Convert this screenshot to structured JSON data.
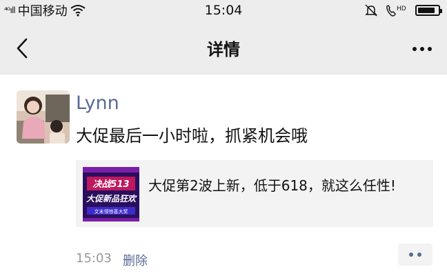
{
  "status_bar": {
    "signal": "⁴ᴳıll",
    "carrier": "中国移动",
    "time": "15:04",
    "hd_label": "HD",
    "battery_level": 0.85
  },
  "nav": {
    "title": "详情",
    "back_icon": "chevron-left-icon",
    "more_icon": "more-dots-icon"
  },
  "post": {
    "author": "Lynn",
    "text": "大促最后一小时啦，抓紧机会哦",
    "link_card": {
      "title": "大促第2波上新，低于618，就这么任性!",
      "thumb_line1": "决战513",
      "thumb_line2": "大促新品狂欢",
      "thumb_line3": "文末领惊喜大奖"
    },
    "time": "15:03",
    "delete_label": "删除"
  },
  "colors": {
    "link_blue": "#576b95",
    "bar_gray": "#ededed",
    "card_gray": "#f3f3f3"
  }
}
